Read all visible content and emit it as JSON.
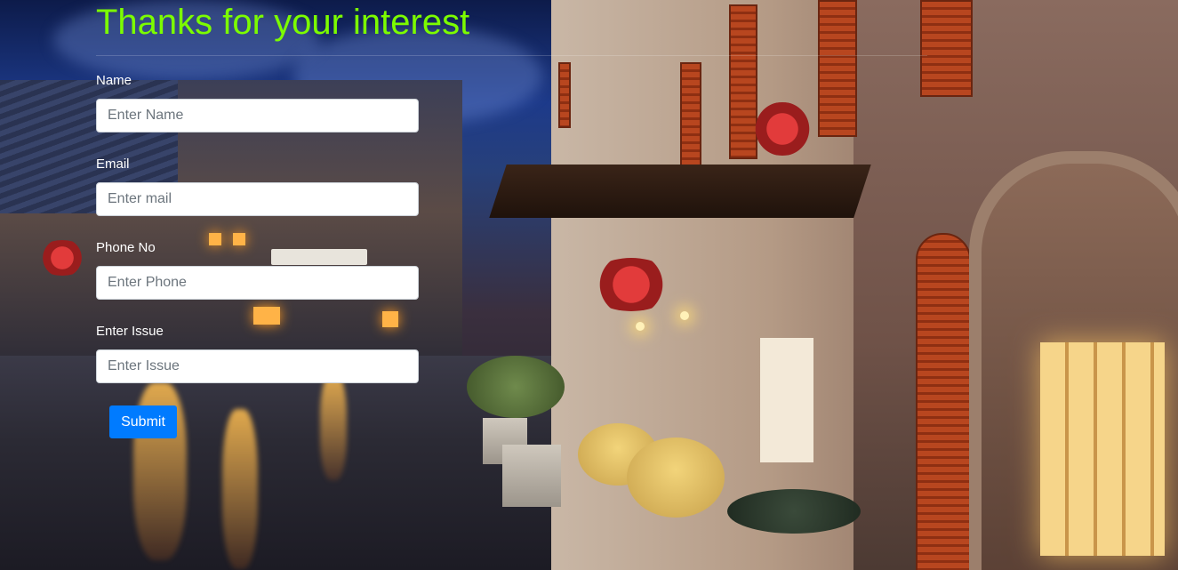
{
  "page": {
    "title": "Thanks for your interest",
    "title_color": "#7cfc00"
  },
  "form": {
    "fields": [
      {
        "label": "Name",
        "placeholder": "Enter Name",
        "value": ""
      },
      {
        "label": "Email",
        "placeholder": "Enter mail",
        "value": ""
      },
      {
        "label": "Phone No",
        "placeholder": "Enter Phone",
        "value": ""
      },
      {
        "label": "Enter Issue",
        "placeholder": "Enter Issue",
        "value": ""
      }
    ],
    "submit_label": "Submit",
    "submit_color": "#007bff"
  },
  "background": {
    "description_icon": "street-scene-background-image"
  }
}
